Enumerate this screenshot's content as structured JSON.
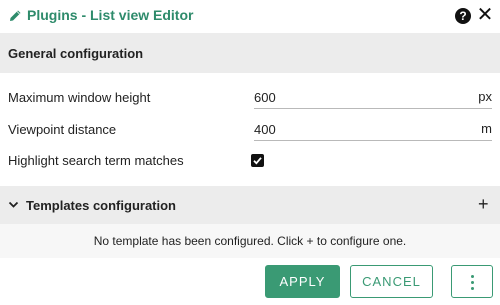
{
  "titlebar": {
    "title": "Plugins - List view Editor",
    "icon": "pencil-icon",
    "help_icon": "question-circle-icon",
    "close_icon": "close-icon",
    "help_glyph": "?",
    "close_glyph": "✕",
    "accent_color": "#2e8b6b"
  },
  "general": {
    "title": "General configuration",
    "fields": {
      "max_height": {
        "label": "Maximum window height",
        "value": "600",
        "unit": "px"
      },
      "viewpoint": {
        "label": "Viewpoint distance",
        "value": "400",
        "unit": "m"
      },
      "highlight": {
        "label": "Highlight search term matches",
        "checked": true
      }
    }
  },
  "templates": {
    "title": "Templates configuration",
    "expand_icon": "chevron-down-icon",
    "add_icon": "plus-icon",
    "add_glyph": "+",
    "empty_message": "No template has been configured. Click + to configure one."
  },
  "actions": {
    "apply_label": "APPLY",
    "cancel_label": "CANCEL",
    "more_icon": "more-vertical-icon",
    "button_color": "#3a9a74"
  }
}
